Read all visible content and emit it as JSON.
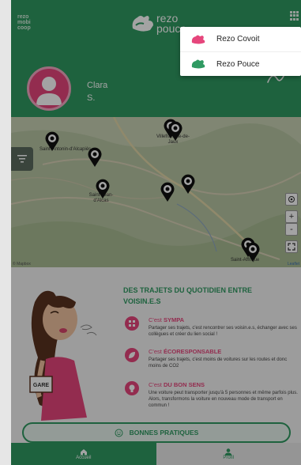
{
  "header": {
    "brand_small": [
      "rezo",
      "mobi",
      "coop"
    ],
    "logo_text": [
      "rezo",
      "pouce"
    ],
    "user_first": "Clara",
    "user_last": "S."
  },
  "dropdown": {
    "items": [
      {
        "label": "Rezo Covoit",
        "icon": "covoit-logo-icon",
        "color": "#e6467c"
      },
      {
        "label": "Rezo Pouce",
        "icon": "pouce-logo-icon",
        "color": "#2f9a62"
      }
    ]
  },
  "map": {
    "towns": [
      "Villefranche-de-Jaux",
      "Saint-Antonin-d'Alcapiès",
      "Saint-Jean-d'Alcas",
      "Saint-Affrique"
    ],
    "zoom_in": "+",
    "zoom_out": "-",
    "attribution_left": "© Mapbox",
    "attribution_right": "Leaflet"
  },
  "content": {
    "title": "DES TRAJETS DU QUOTIDIEN ENTRE VOISIN.E.S",
    "features": [
      {
        "prefix": "C'est ",
        "title": "SYMPA",
        "text": "Partager ses trajets, c'est rencontrer ses voisin.e.s, échanger avec ses collègues et créer du lien social !"
      },
      {
        "prefix": "C'est ",
        "title": "ÉCORESPONSABLE",
        "text": "Partager ses trajets, c'est moins de voitures sur les routes et donc moins de CO2"
      },
      {
        "prefix": "C'est ",
        "title": "DU BON SENS",
        "text": "Une voiture peut transporter jusqu'à 5 personnes et même parfois plus. Alors, transformons la voiture en nouveau mode de transport en commun !"
      }
    ],
    "sign_text": "GARE",
    "good_practices": "BONNES PRATIQUES"
  },
  "nav": {
    "home": "Accueil",
    "profile": "Profil"
  },
  "colors": {
    "green": "#2f9a62",
    "pink": "#e6467c"
  }
}
